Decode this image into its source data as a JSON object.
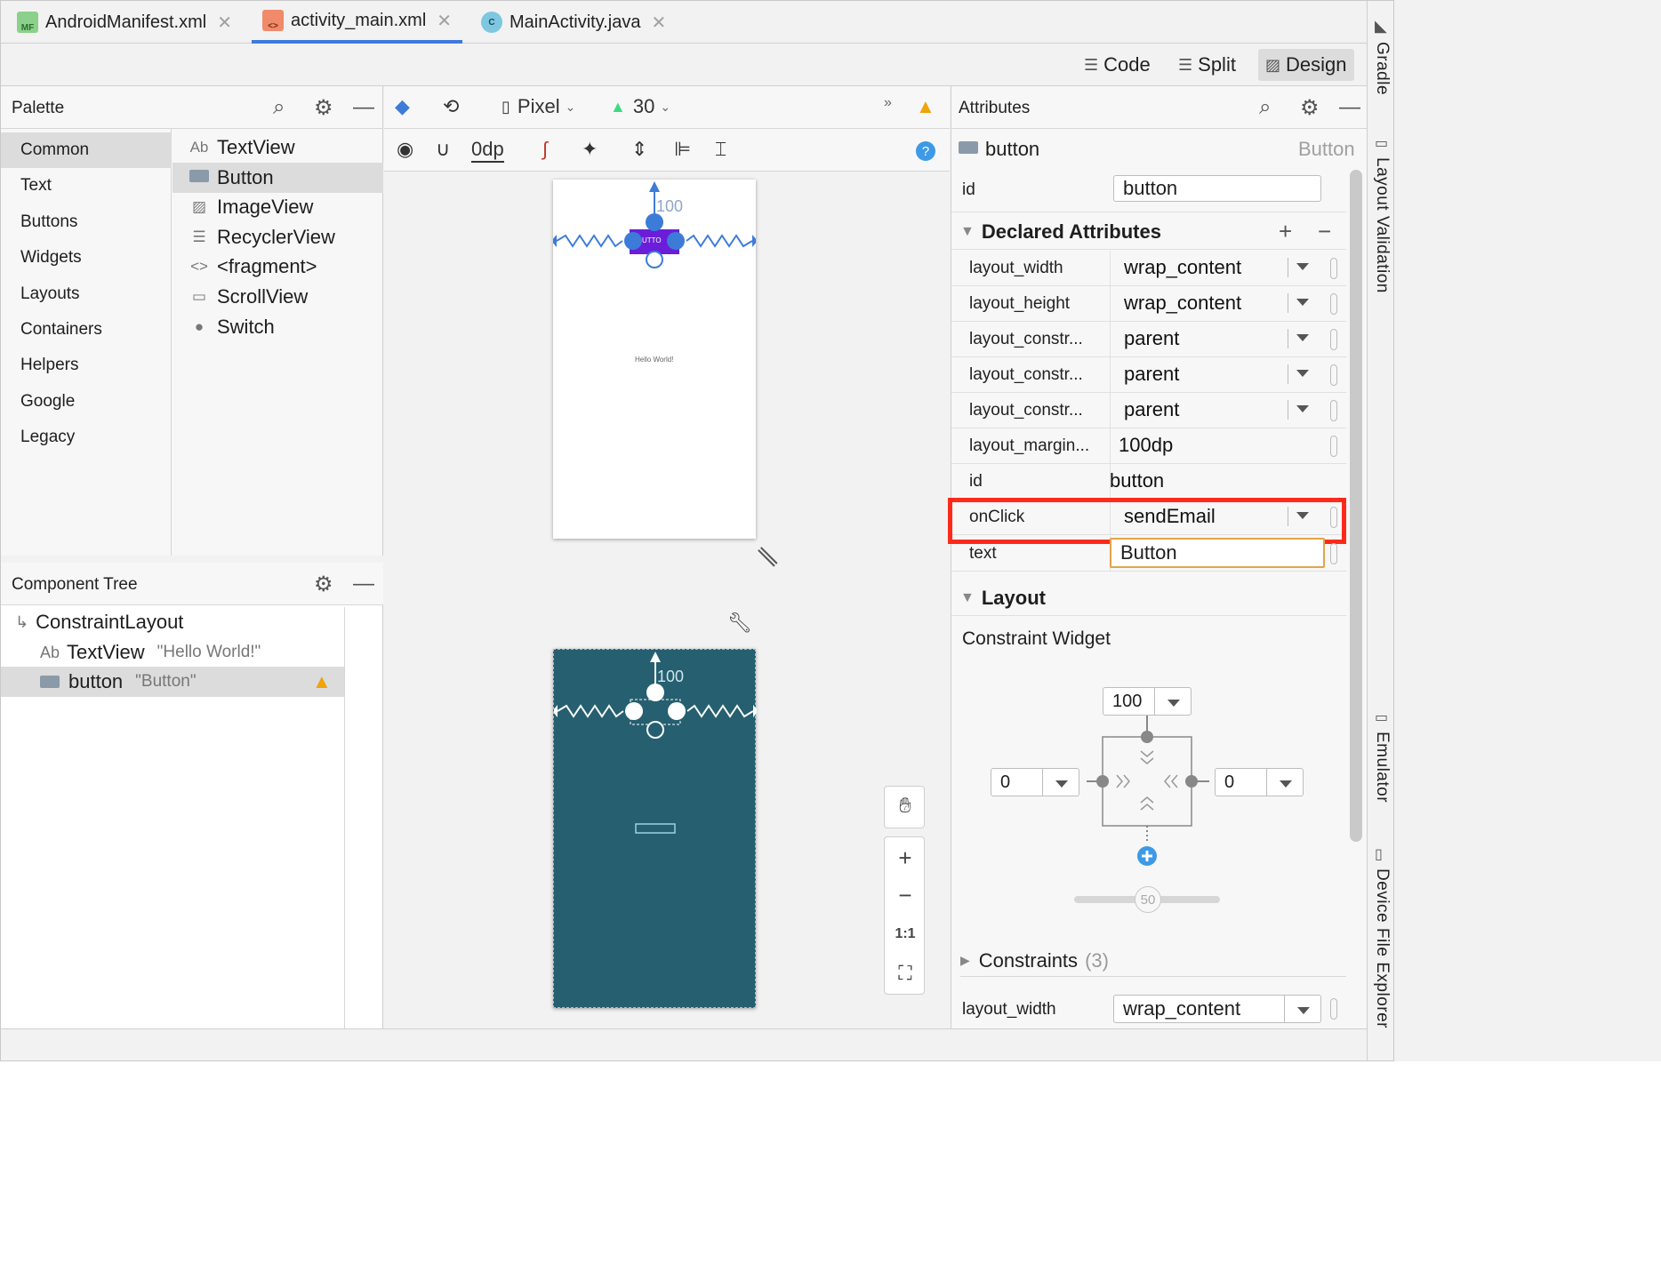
{
  "tabs": [
    {
      "label": "AndroidManifest.xml",
      "icon": "manifest-file-icon"
    },
    {
      "label": "activity_main.xml",
      "icon": "layout-file-icon"
    },
    {
      "label": "MainActivity.java",
      "icon": "java-class-icon"
    }
  ],
  "view_modes": {
    "code": "Code",
    "split": "Split",
    "design": "Design"
  },
  "palette": {
    "title": "Palette",
    "categories": [
      "Common",
      "Text",
      "Buttons",
      "Widgets",
      "Layouts",
      "Containers",
      "Helpers",
      "Google",
      "Legacy"
    ],
    "widgets": [
      {
        "label": "TextView",
        "icon": "Ab"
      },
      {
        "label": "Button",
        "icon": "button-icon"
      },
      {
        "label": "ImageView",
        "icon": "image-icon"
      },
      {
        "label": "RecyclerView",
        "icon": "list-icon"
      },
      {
        "label": "<fragment>",
        "icon": "code-icon"
      },
      {
        "label": "ScrollView",
        "icon": "scroll-icon"
      },
      {
        "label": "Switch",
        "icon": "switch-icon"
      }
    ]
  },
  "component_tree": {
    "title": "Component Tree",
    "rows": [
      {
        "label": "ConstraintLayout",
        "sub": ""
      },
      {
        "label": "TextView",
        "sub": "\"Hello World!\"",
        "icon": "Ab"
      },
      {
        "label": "button",
        "sub": "\"Button\""
      }
    ]
  },
  "canvas": {
    "device": "Pixel",
    "api": "30",
    "margin": "0dp",
    "hello_text": "Hello World!",
    "button_text": "UTTO",
    "margin_label": "100",
    "zoom_one_to_one": "1:1"
  },
  "attributes": {
    "title": "Attributes",
    "selected_name": "button",
    "selected_type": "Button",
    "id_label": "id",
    "id_value": "button",
    "declared_title": "Declared Attributes",
    "declared": [
      {
        "key": "layout_width",
        "value": "wrap_content",
        "dropdown": true
      },
      {
        "key": "layout_height",
        "value": "wrap_content",
        "dropdown": true
      },
      {
        "key": "layout_constr...",
        "value": "parent",
        "dropdown": true
      },
      {
        "key": "layout_constr...",
        "value": "parent",
        "dropdown": true
      },
      {
        "key": "layout_constr...",
        "value": "parent",
        "dropdown": true
      },
      {
        "key": "layout_margin...",
        "value": "100dp",
        "dropdown": false
      },
      {
        "key": "id",
        "value": "button",
        "dropdown": false
      },
      {
        "key": "onClick",
        "value": "sendEmail",
        "dropdown": true
      },
      {
        "key": "text",
        "value": "Button",
        "dropdown": false
      }
    ],
    "layout_title": "Layout",
    "constraint_widget_title": "Constraint Widget",
    "cw_top": "100",
    "cw_left": "0",
    "cw_right": "0",
    "cw_bias": "50",
    "constraints_title": "Constraints",
    "constraints_count": "(3)",
    "layout_width_key": "layout_width",
    "layout_width_value": "wrap_content"
  },
  "rail": {
    "gradle": "Gradle",
    "layout_validation": "Layout Validation",
    "emulator": "Emulator",
    "device_file_explorer": "Device File Explorer"
  },
  "colors": {
    "accent": "#3d7bd9",
    "highlight": "#ff2a1a",
    "blueprint": "#255f70",
    "warning": "#f0a30a"
  }
}
